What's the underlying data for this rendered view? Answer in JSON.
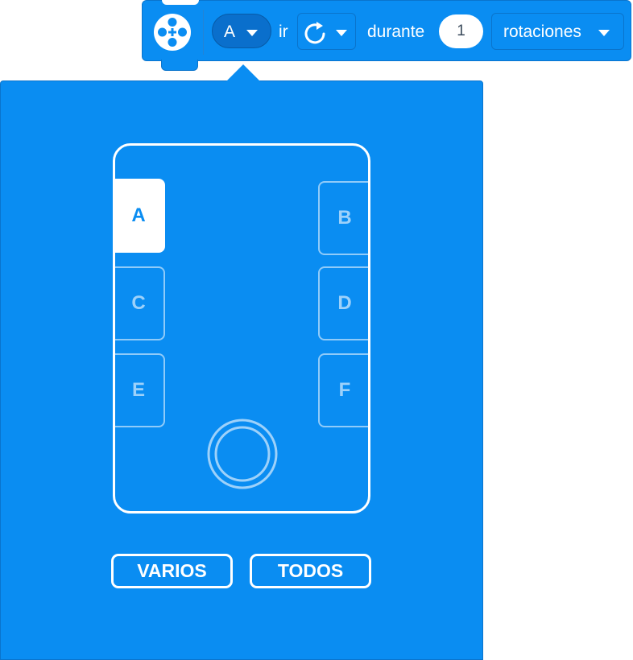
{
  "block": {
    "icon": "motor-icon",
    "port_value": "A",
    "verb": "ir",
    "direction_icon": "clockwise-arrow-icon",
    "for_word": "durante",
    "amount_value": "1",
    "unit_value": "rotaciones"
  },
  "port_picker": {
    "selected_port": "A",
    "ports": {
      "a": "A",
      "b": "B",
      "c": "C",
      "d": "D",
      "e": "E",
      "f": "F"
    },
    "multiple_label": "VARIOS",
    "all_label": "TODOS"
  },
  "colors": {
    "accent": "#0a8df2",
    "accent_dark": "#0a6fcc",
    "text_on_accent": "#ffffff"
  }
}
